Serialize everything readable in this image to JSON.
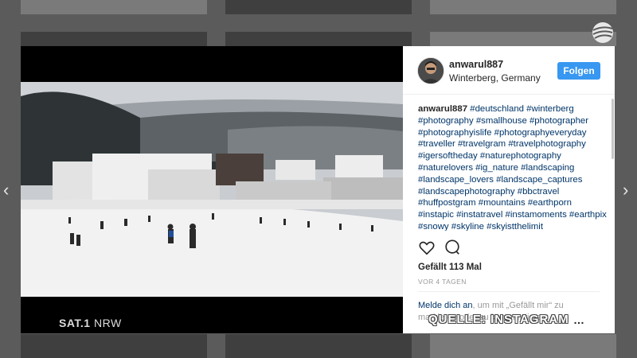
{
  "post": {
    "username": "anwarul887",
    "location": "Winterberg, Germany",
    "follow_label": "Folgen",
    "caption_author": "anwarul887",
    "caption_text": "#deutschland #winterberg #photography #smallhouse #photographer #photographyislife #photographyeveryday #traveller #travelgram #travelphotography #igersoftheday #naturephotography #naturelovers #ig_nature #landscaping #landscape_lovers #landscape_captures #landscapephotography #bbctravel #huffpostgram #mountains #earthporn #instapic #instatravel #instamoments #earthpix #snowy #skyline #skyistthelimit",
    "likes": "Gefällt 113 Mal",
    "time_ago": "VOR 4 TAGEN",
    "login_link": "Melde dich an",
    "login_text": ", um mit „Gefällt mir“ zu markieren oder zu kommentieren.",
    "more_icon": "…",
    "accent_color": "#3897f0"
  },
  "nav": {
    "prev_arrow": "‹",
    "next_arrow": "›"
  },
  "overlay": {
    "channel_brand": "SAT.1",
    "channel_region": "NRW",
    "credit": "QUELLE: INSTAGRAM"
  },
  "icons": {
    "like": "heart-icon",
    "comment": "comment-icon",
    "broadcaster_logo": "sat1-ball-icon"
  }
}
